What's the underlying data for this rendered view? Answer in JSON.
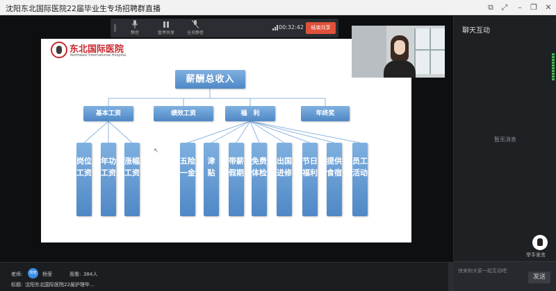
{
  "window": {
    "title": "沈阳东北国际医院22届毕业生专场招聘群直播"
  },
  "toolbar": {
    "items": [
      {
        "label": "静音",
        "icon": "microphone-icon"
      },
      {
        "label": "暂停共享",
        "icon": "pause-icon"
      },
      {
        "label": "全员静音",
        "icon": "mute-all-icon"
      }
    ],
    "time": "00:32:42",
    "end_share": "结束共享"
  },
  "slide": {
    "logo_cn": "东北国际医院",
    "logo_en": "Northeast International Hospital",
    "root": "薪酬总收入",
    "categories": [
      "基本工资",
      "绩效工资",
      "福　利",
      "年终奖"
    ],
    "leaves": [
      "岗位工资",
      "年功工资",
      "涨幅工资",
      "五险一金",
      "津　贴",
      "带薪假期",
      "免费体检",
      "出国进修",
      "节日福利",
      "提供食宿",
      "员工活动"
    ],
    "colors": {
      "box": "#5b93cf",
      "line": "#8eb5de"
    }
  },
  "chat": {
    "title": "聊天互动",
    "empty": "暂无消息",
    "raise_hand": "举手发言",
    "placeholder": "快来和大家一起互动吧",
    "send": "发送"
  },
  "info": {
    "teacher_label": "老师:",
    "teacher_badge": "校管",
    "teacher_name": "杨莹",
    "viewers_label": "观看:",
    "viewers_count": "384人",
    "subject_label": "标题:",
    "subject": "沈阳东北国际医院22届护理毕..."
  },
  "colors": {
    "accent": "#e0513a",
    "badge": "#3a8ee6"
  }
}
